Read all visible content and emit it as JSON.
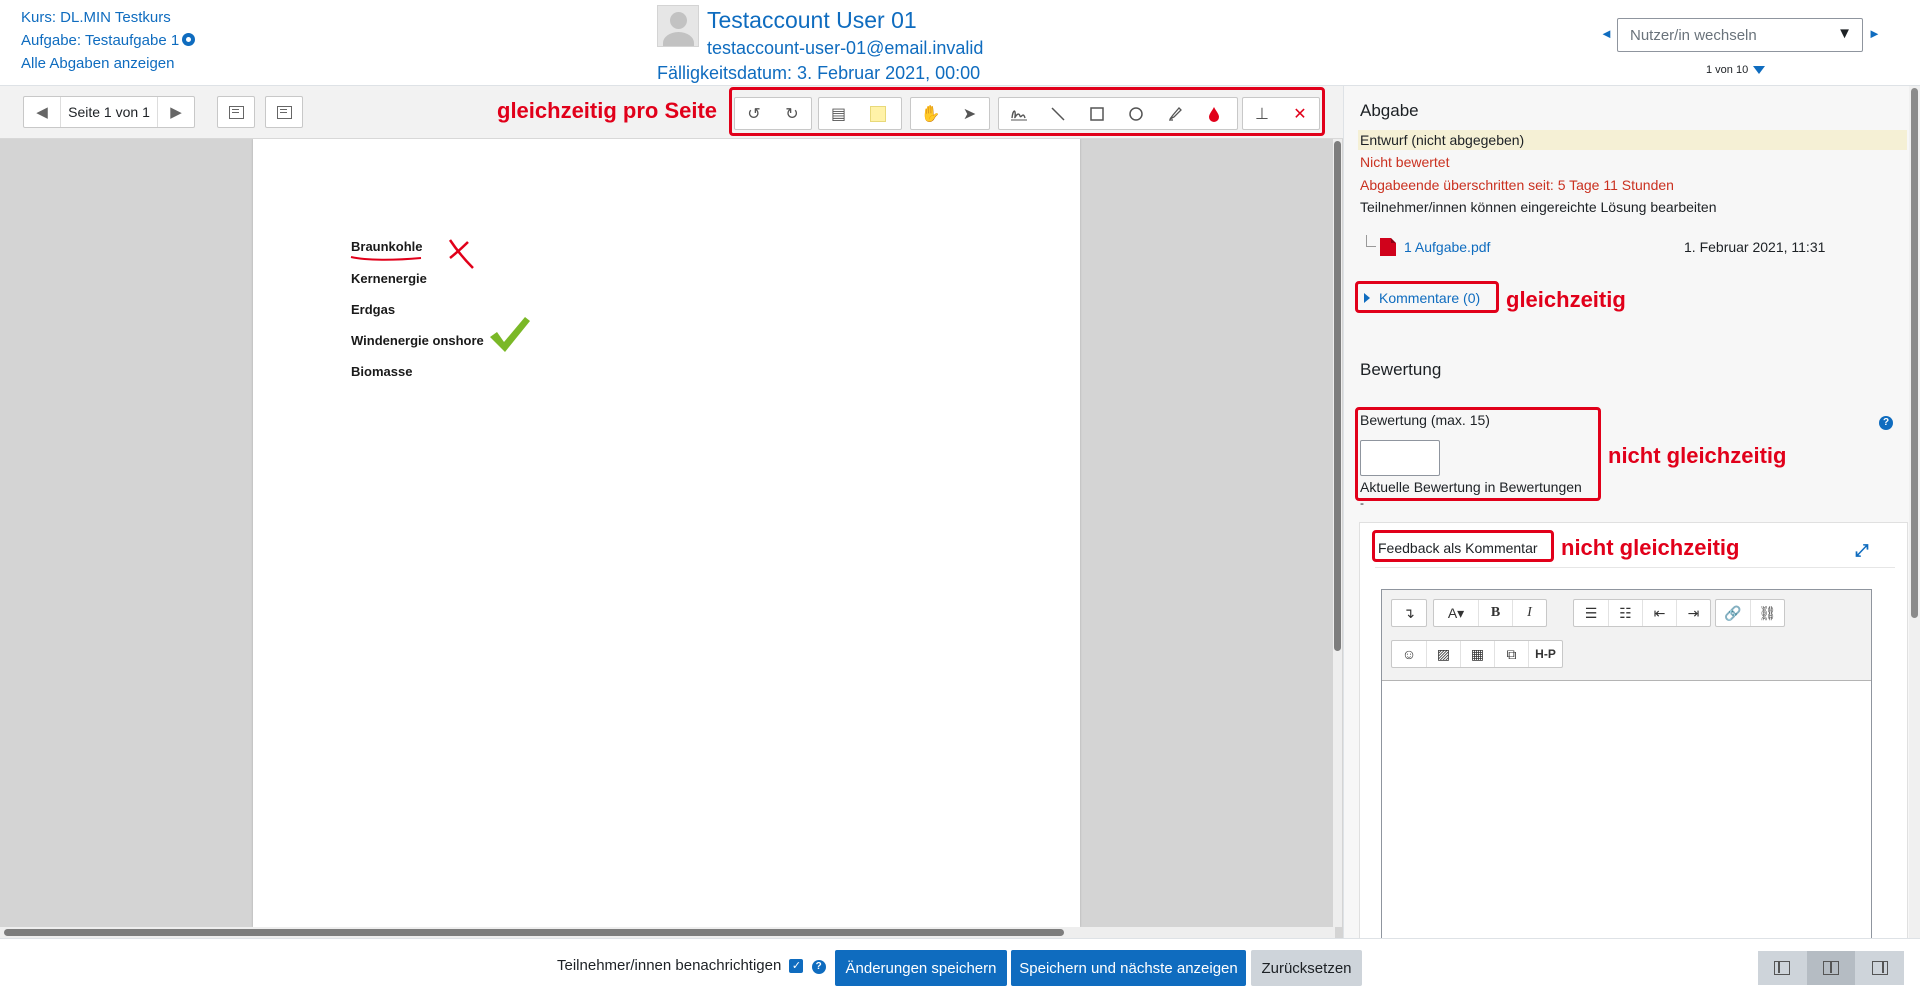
{
  "header": {
    "course_link": "Kurs: DL.MIN Testkurs",
    "assignment_link": "Aufgabe: Testaufgabe 1",
    "all_submissions_link": "Alle Abgaben anzeigen",
    "user_name": "Testaccount User 01",
    "user_email": "testaccount-user-01@email.invalid",
    "due_date": "Fälligkeitsdatum: 3. Februar 2021, 00:00",
    "user_switch_placeholder": "Nutzer/in wechseln",
    "user_count": "1 von 10",
    "prev_user_icon": "◄",
    "next_user_icon": "►",
    "caret": "▼"
  },
  "pdf_toolbar": {
    "prev_page_icon": "◀",
    "next_page_icon": "▶",
    "page_label": "Seite 1 von 1",
    "annotation_label": "gleichzeitig pro Seite",
    "tools": {
      "rotate_left": "↺",
      "rotate_right": "↻",
      "comment": "▤",
      "pan": "✋",
      "select": "➤",
      "stamp": "⊥",
      "delete": "✕"
    }
  },
  "pdf_page": {
    "lines": [
      "Braunkohle",
      "Kernenergie",
      "Erdgas",
      "Windenergie onshore",
      "Biomasse"
    ]
  },
  "right_pane": {
    "submission_heading": "Abgabe",
    "status_draft": "Entwurf (nicht abgegeben)",
    "status_not_graded": "Nicht bewertet",
    "status_overdue": "Abgabeende überschritten seit: 5 Tage 11 Stunden",
    "status_edit": "Teilnehmer/innen können eingereichte Lösung bearbeiten",
    "file_name": "1 Aufgabe.pdf",
    "file_date": "1. Februar 2021, 11:31",
    "comments_link": "Kommentare (0)",
    "comments_annotation": "gleichzeitig",
    "grading_heading": "Bewertung",
    "grade_label": "Bewertung (max. 15)",
    "grade_value": "",
    "grade_current": "Aktuelle Bewertung in Bewertungen",
    "grade_dash": "-",
    "grade_annotation": "nicht gleichzeitig",
    "feedback_label": "Feedback als Kommentar",
    "feedback_annotation": "nicht gleichzeitig",
    "expand_icon": "⤢",
    "help_icon": "?",
    "editor_buttons_row1": [
      "↴",
      "A▾",
      "B",
      "I",
      "☰",
      "☷",
      "⇤",
      "⇥",
      "🔗",
      "⛓"
    ],
    "editor_buttons_row2": [
      "☺",
      "▨",
      "▦",
      "⧉",
      "H-P"
    ]
  },
  "footer": {
    "notify_label": "Teilnehmer/innen benachrichtigen",
    "notify_checked": "✓",
    "help_icon": "?",
    "save_button": "Änderungen speichern",
    "save_next_button": "Speichern und nächste anzeigen",
    "reset_button": "Zurücksetzen"
  },
  "colors": {
    "accent": "#0f6cbf",
    "annotation_red": "#e1001a",
    "status_red": "#ca3120",
    "draft_bg": "#f5f0d5"
  }
}
